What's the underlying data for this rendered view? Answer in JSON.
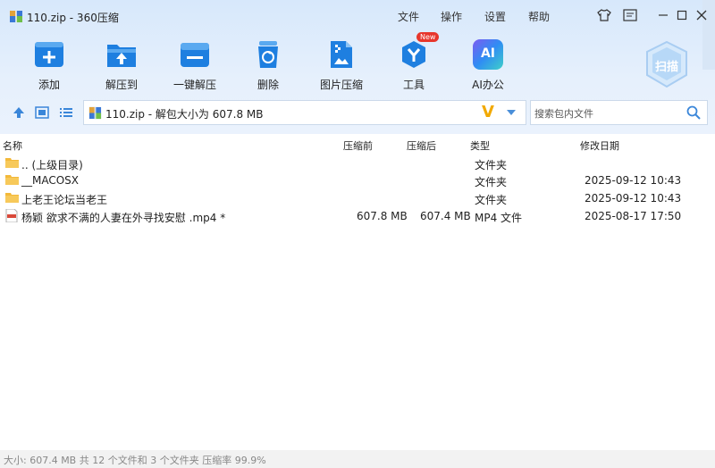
{
  "window": {
    "title": "110.zip - 360压缩"
  },
  "menu": [
    "文件",
    "操作",
    "设置",
    "帮助"
  ],
  "toolbar": [
    {
      "label": "添加",
      "icon": "add-icon"
    },
    {
      "label": "解压到",
      "icon": "extract-to-icon"
    },
    {
      "label": "一键解压",
      "icon": "one-click-extract-icon"
    },
    {
      "label": "删除",
      "icon": "trash-icon"
    },
    {
      "label": "图片压缩",
      "icon": "image-compress-icon"
    },
    {
      "label": "工具",
      "icon": "tools-icon",
      "badge": "New"
    },
    {
      "label": "AI办公",
      "icon": "ai-icon",
      "icon_text": "AI"
    }
  ],
  "scan": {
    "label": "扫描"
  },
  "address": {
    "text": "110.zip - 解包大小为 607.8 MB",
    "logo": "V"
  },
  "search": {
    "placeholder": "搜索包内文件"
  },
  "columns": {
    "name": "名称",
    "original": "压缩前",
    "compressed": "压缩后",
    "type": "类型",
    "modified": "修改日期"
  },
  "files": [
    {
      "name": ".. (上级目录)",
      "original": "",
      "compressed": "",
      "type": "文件夹",
      "modified": "",
      "kind": "folder"
    },
    {
      "name": "__MACOSX",
      "original": "",
      "compressed": "",
      "type": "文件夹",
      "modified": "2025-09-12 10:43",
      "kind": "folder"
    },
    {
      "name": "上老王论坛当老王",
      "original": "",
      "compressed": "",
      "type": "文件夹",
      "modified": "2025-09-12 10:43",
      "kind": "folder"
    },
    {
      "name": "杨颖 欲求不满的人妻在外寻找安慰 .mp4 *",
      "original": "607.8 MB",
      "compressed": "607.4 MB",
      "type": "MP4 文件",
      "modified": "2025-08-17 17:50",
      "kind": "video"
    }
  ],
  "status": {
    "text": "大小: 607.4 MB 共 12 个文件和 3 个文件夹 压缩率 99.9%"
  },
  "colors": {
    "accent": "#1e7fe0",
    "folder": "#f3b93a",
    "badge": "#e7362c",
    "logo": "#f2a900"
  }
}
